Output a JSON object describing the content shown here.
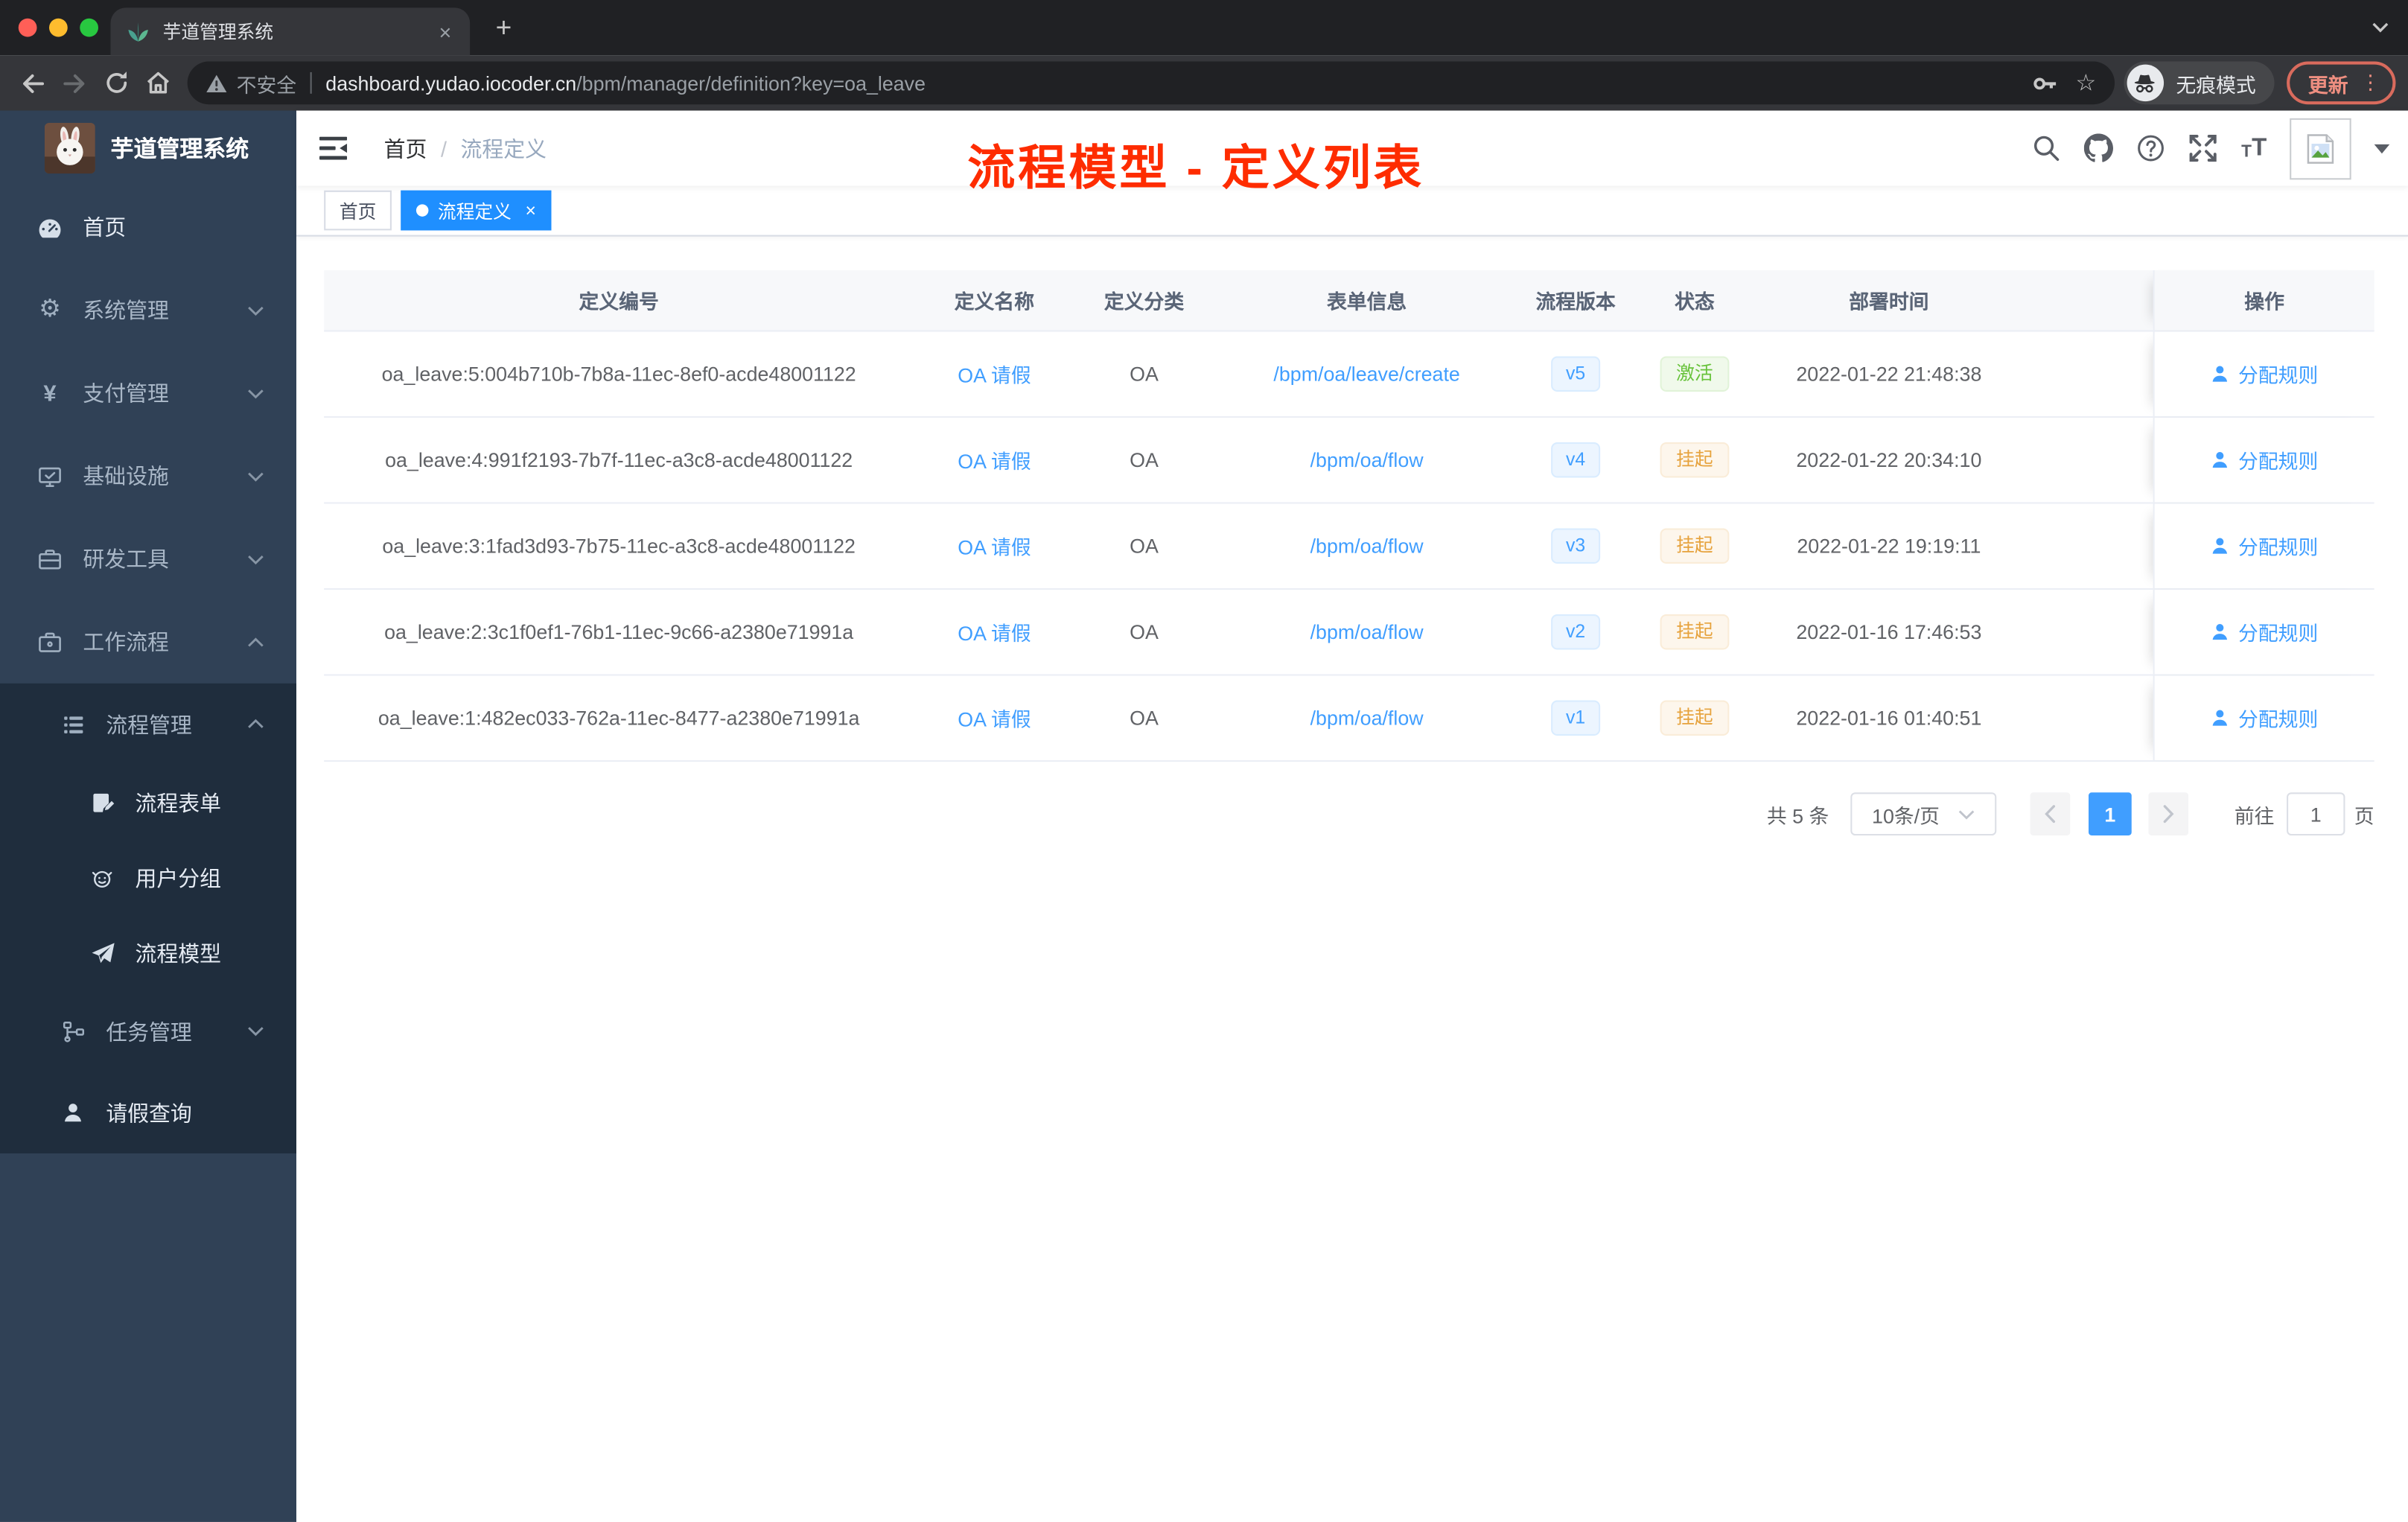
{
  "browser": {
    "tab": {
      "title": "芋道管理系统",
      "close": "×"
    },
    "new_tab": "+",
    "omnibox": {
      "security_label": "不安全",
      "host": "dashboard.yudao.iocoder.cn",
      "path": "/bpm/manager/definition?key=oa_leave"
    },
    "incognito_label": "无痕模式",
    "update_label": "更新",
    "menu_dots": "⋮"
  },
  "sidebar": {
    "logo_title": "芋道管理系统",
    "menu": [
      {
        "label": "首页"
      },
      {
        "label": "系统管理"
      },
      {
        "label": "支付管理"
      },
      {
        "label": "基础设施"
      },
      {
        "label": "研发工具"
      },
      {
        "label": "工作流程"
      }
    ],
    "workflow_submenu": [
      {
        "label": "流程管理"
      },
      {
        "label": "流程表单"
      },
      {
        "label": "用户分组"
      },
      {
        "label": "流程模型"
      },
      {
        "label": "任务管理"
      },
      {
        "label": "请假查询"
      }
    ]
  },
  "header": {
    "breadcrumb": {
      "home": "首页",
      "separator": "/",
      "current": "流程定义"
    },
    "annotation_title": "流程模型 - 定义列表"
  },
  "tags": {
    "items": [
      {
        "label": "首页"
      },
      {
        "label": "流程定义",
        "close": "×"
      }
    ]
  },
  "table": {
    "columns": [
      "定义编号",
      "定义名称",
      "定义分类",
      "表单信息",
      "流程版本",
      "状态",
      "部署时间",
      "操作"
    ],
    "rows": [
      {
        "id": "oa_leave:5:004b710b-7b8a-11ec-8ef0-acde48001122",
        "name": "OA 请假",
        "category": "OA",
        "form": "/bpm/oa/leave/create",
        "version": "v5",
        "status": "激活",
        "deployed_at": "2022-01-22 21:48:38",
        "action": "分配规则"
      },
      {
        "id": "oa_leave:4:991f2193-7b7f-11ec-a3c8-acde48001122",
        "name": "OA 请假",
        "category": "OA",
        "form": "/bpm/oa/flow",
        "version": "v4",
        "status": "挂起",
        "deployed_at": "2022-01-22 20:34:10",
        "action": "分配规则"
      },
      {
        "id": "oa_leave:3:1fad3d93-7b75-11ec-a3c8-acde48001122",
        "name": "OA 请假",
        "category": "OA",
        "form": "/bpm/oa/flow",
        "version": "v3",
        "status": "挂起",
        "deployed_at": "2022-01-22 19:19:11",
        "action": "分配规则"
      },
      {
        "id": "oa_leave:2:3c1f0ef1-76b1-11ec-9c66-a2380e71991a",
        "name": "OA 请假",
        "category": "OA",
        "form": "/bpm/oa/flow",
        "version": "v2",
        "status": "挂起",
        "deployed_at": "2022-01-16 17:46:53",
        "action": "分配规则"
      },
      {
        "id": "oa_leave:1:482ec033-762a-11ec-8477-a2380e71991a",
        "name": "OA 请假",
        "category": "OA",
        "form": "/bpm/oa/flow",
        "version": "v1",
        "status": "挂起",
        "deployed_at": "2022-01-16 01:40:51",
        "action": "分配规则"
      }
    ]
  },
  "pagination": {
    "total": "共 5 条",
    "page_size": "10条/页",
    "current": "1",
    "goto": "前往",
    "goto_value": "1",
    "unit": "页"
  },
  "colors": {
    "primary": "#409eff",
    "tag_active_bg": "#1f8fff",
    "status_active": "#67c23a",
    "status_suspended": "#e6a23c",
    "annotation_red": "#fe2c00",
    "sidebar_bg": "#304156",
    "submenu_bg": "#1f2d3d"
  },
  "icons": {
    "star_glyph": "☆",
    "gear_glyph": "⚙",
    "yen_glyph": "¥",
    "map": {
      "favicon": "sprout-leaves",
      "security": "warning-triangle",
      "key": "password-key",
      "star": "bookmark-star",
      "incognito": "spy-hat-glasses",
      "logo": "rabbit-photo",
      "avatar": "broken-image-placeholder",
      "fold": "collapse-sidebar",
      "search": "magnifier",
      "github": "octocat",
      "help": "question-circle",
      "fullscreen": "expand-arrows",
      "font_size": "tT",
      "action": "user-silhouette"
    }
  }
}
